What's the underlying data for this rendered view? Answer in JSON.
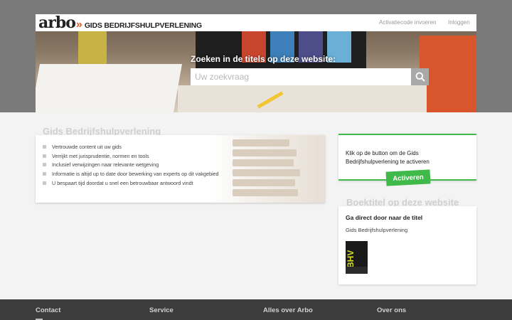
{
  "header": {
    "logo_word": "arbo",
    "logo_title": "GIDS BEDRIJFSHULPVERLENING",
    "links": {
      "activate": "Activatiecode invoeren",
      "login": "Inloggen"
    }
  },
  "hero": {
    "search_label": "Zoeken in de titels op deze website:",
    "search_placeholder": "Uw zoekvraag"
  },
  "features": {
    "title": "Gids Bedrijfshulpverlening",
    "items": [
      "Vertrouwde content uit uw gids",
      "Verrijkt met jurisprudentie, normen en tools",
      "Inclusief verwijzingen naar relevante wetgeving",
      "Informatie is altijd up to date door bewerking van experts op dit vakgebied",
      "U bespaart tijd doordat u snel een betrouwbaar antwoord vindt"
    ]
  },
  "activate": {
    "text": "Klik op de button om de Gids Bedrijfshulpverlening te activeren",
    "button": "Activeren"
  },
  "books": {
    "section_title": "Boektitel op deze website",
    "heading": "Ga direct door naar de titel",
    "title": "Gids Bedrijfshulpverlening",
    "cover_text": "BHV"
  },
  "footer": {
    "columns": [
      "Contact",
      "Service",
      "Alles over Arbo",
      "Over ons"
    ]
  },
  "colors": {
    "accent_green": "#3fb94a",
    "brand_orange": "#e65c2a",
    "footer_bg": "#3c3c3c"
  }
}
